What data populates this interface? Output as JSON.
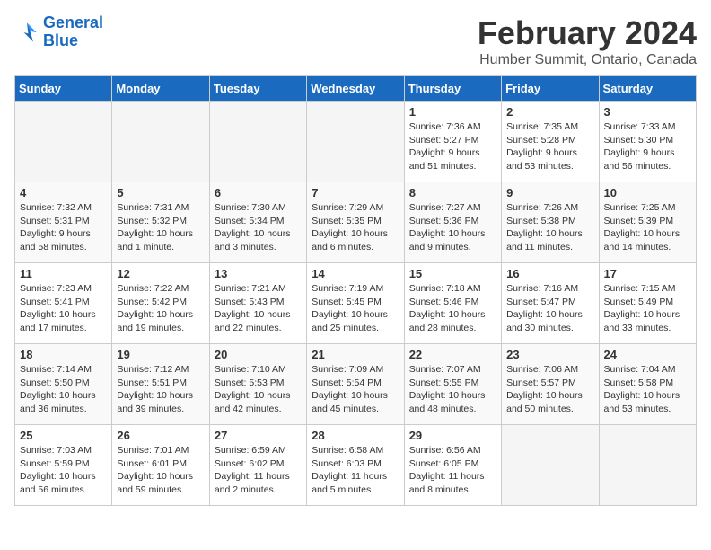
{
  "logo": {
    "text_general": "General",
    "text_blue": "Blue"
  },
  "title": "February 2024",
  "subtitle": "Humber Summit, Ontario, Canada",
  "weekdays": [
    "Sunday",
    "Monday",
    "Tuesday",
    "Wednesday",
    "Thursday",
    "Friday",
    "Saturday"
  ],
  "weeks": [
    [
      {
        "day": "",
        "info": ""
      },
      {
        "day": "",
        "info": ""
      },
      {
        "day": "",
        "info": ""
      },
      {
        "day": "",
        "info": ""
      },
      {
        "day": "1",
        "info": "Sunrise: 7:36 AM\nSunset: 5:27 PM\nDaylight: 9 hours\nand 51 minutes."
      },
      {
        "day": "2",
        "info": "Sunrise: 7:35 AM\nSunset: 5:28 PM\nDaylight: 9 hours\nand 53 minutes."
      },
      {
        "day": "3",
        "info": "Sunrise: 7:33 AM\nSunset: 5:30 PM\nDaylight: 9 hours\nand 56 minutes."
      }
    ],
    [
      {
        "day": "4",
        "info": "Sunrise: 7:32 AM\nSunset: 5:31 PM\nDaylight: 9 hours\nand 58 minutes."
      },
      {
        "day": "5",
        "info": "Sunrise: 7:31 AM\nSunset: 5:32 PM\nDaylight: 10 hours\nand 1 minute."
      },
      {
        "day": "6",
        "info": "Sunrise: 7:30 AM\nSunset: 5:34 PM\nDaylight: 10 hours\nand 3 minutes."
      },
      {
        "day": "7",
        "info": "Sunrise: 7:29 AM\nSunset: 5:35 PM\nDaylight: 10 hours\nand 6 minutes."
      },
      {
        "day": "8",
        "info": "Sunrise: 7:27 AM\nSunset: 5:36 PM\nDaylight: 10 hours\nand 9 minutes."
      },
      {
        "day": "9",
        "info": "Sunrise: 7:26 AM\nSunset: 5:38 PM\nDaylight: 10 hours\nand 11 minutes."
      },
      {
        "day": "10",
        "info": "Sunrise: 7:25 AM\nSunset: 5:39 PM\nDaylight: 10 hours\nand 14 minutes."
      }
    ],
    [
      {
        "day": "11",
        "info": "Sunrise: 7:23 AM\nSunset: 5:41 PM\nDaylight: 10 hours\nand 17 minutes."
      },
      {
        "day": "12",
        "info": "Sunrise: 7:22 AM\nSunset: 5:42 PM\nDaylight: 10 hours\nand 19 minutes."
      },
      {
        "day": "13",
        "info": "Sunrise: 7:21 AM\nSunset: 5:43 PM\nDaylight: 10 hours\nand 22 minutes."
      },
      {
        "day": "14",
        "info": "Sunrise: 7:19 AM\nSunset: 5:45 PM\nDaylight: 10 hours\nand 25 minutes."
      },
      {
        "day": "15",
        "info": "Sunrise: 7:18 AM\nSunset: 5:46 PM\nDaylight: 10 hours\nand 28 minutes."
      },
      {
        "day": "16",
        "info": "Sunrise: 7:16 AM\nSunset: 5:47 PM\nDaylight: 10 hours\nand 30 minutes."
      },
      {
        "day": "17",
        "info": "Sunrise: 7:15 AM\nSunset: 5:49 PM\nDaylight: 10 hours\nand 33 minutes."
      }
    ],
    [
      {
        "day": "18",
        "info": "Sunrise: 7:14 AM\nSunset: 5:50 PM\nDaylight: 10 hours\nand 36 minutes."
      },
      {
        "day": "19",
        "info": "Sunrise: 7:12 AM\nSunset: 5:51 PM\nDaylight: 10 hours\nand 39 minutes."
      },
      {
        "day": "20",
        "info": "Sunrise: 7:10 AM\nSunset: 5:53 PM\nDaylight: 10 hours\nand 42 minutes."
      },
      {
        "day": "21",
        "info": "Sunrise: 7:09 AM\nSunset: 5:54 PM\nDaylight: 10 hours\nand 45 minutes."
      },
      {
        "day": "22",
        "info": "Sunrise: 7:07 AM\nSunset: 5:55 PM\nDaylight: 10 hours\nand 48 minutes."
      },
      {
        "day": "23",
        "info": "Sunrise: 7:06 AM\nSunset: 5:57 PM\nDaylight: 10 hours\nand 50 minutes."
      },
      {
        "day": "24",
        "info": "Sunrise: 7:04 AM\nSunset: 5:58 PM\nDaylight: 10 hours\nand 53 minutes."
      }
    ],
    [
      {
        "day": "25",
        "info": "Sunrise: 7:03 AM\nSunset: 5:59 PM\nDaylight: 10 hours\nand 56 minutes."
      },
      {
        "day": "26",
        "info": "Sunrise: 7:01 AM\nSunset: 6:01 PM\nDaylight: 10 hours\nand 59 minutes."
      },
      {
        "day": "27",
        "info": "Sunrise: 6:59 AM\nSunset: 6:02 PM\nDaylight: 11 hours\nand 2 minutes."
      },
      {
        "day": "28",
        "info": "Sunrise: 6:58 AM\nSunset: 6:03 PM\nDaylight: 11 hours\nand 5 minutes."
      },
      {
        "day": "29",
        "info": "Sunrise: 6:56 AM\nSunset: 6:05 PM\nDaylight: 11 hours\nand 8 minutes."
      },
      {
        "day": "",
        "info": ""
      },
      {
        "day": "",
        "info": ""
      }
    ]
  ]
}
